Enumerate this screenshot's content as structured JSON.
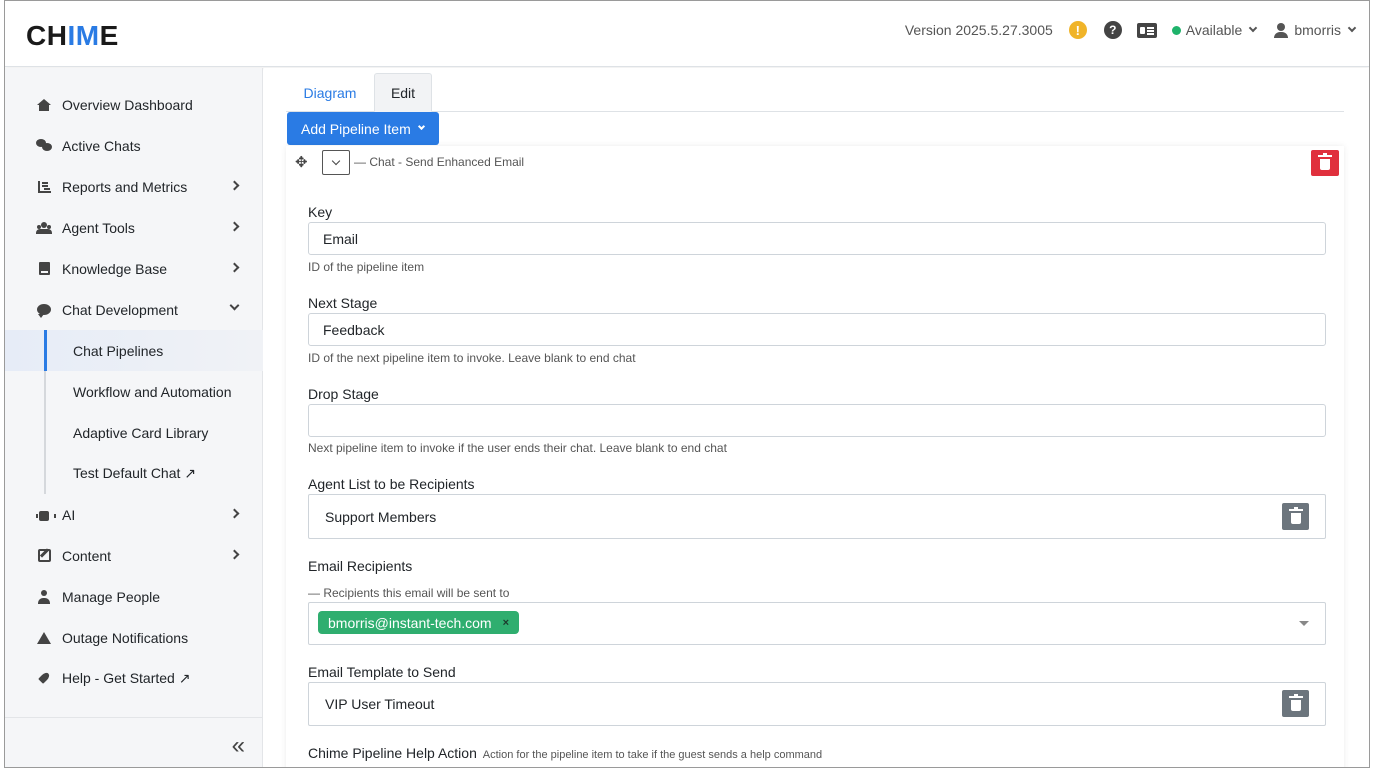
{
  "header": {
    "logo_prefix": "CH",
    "logo_accent": "IM",
    "logo_suffix": "E",
    "version": "Version 2025.5.27.3005",
    "warn_glyph": "!",
    "help_glyph": "?",
    "status": "Available",
    "status_color": "#1fb36b",
    "username": "bmorris"
  },
  "sidebar": {
    "items": [
      {
        "label": "Overview Dashboard",
        "icon": "home-icon"
      },
      {
        "label": "Active Chats",
        "icon": "chats-icon"
      },
      {
        "label": "Reports and Metrics",
        "icon": "reports-icon"
      },
      {
        "label": "Agent Tools",
        "icon": "users-icon"
      },
      {
        "label": "Knowledge Base",
        "icon": "book-icon"
      },
      {
        "label": "Chat Development",
        "icon": "comment-icon"
      }
    ],
    "sub_items": [
      {
        "label": "Chat Pipelines",
        "active": true
      },
      {
        "label": "Workflow and Automation"
      },
      {
        "label": "Adaptive Card Library"
      },
      {
        "label": "Test Default Chat ↗"
      }
    ],
    "items_after": [
      {
        "label": "AI",
        "icon": "robot-icon"
      },
      {
        "label": "Content",
        "icon": "edit-icon"
      },
      {
        "label": "Manage People",
        "icon": "person-icon"
      },
      {
        "label": "Outage Notifications",
        "icon": "alert-icon"
      },
      {
        "label": "Help - Get Started ↗",
        "icon": "rocket-icon"
      }
    ],
    "collapse_glyph": "«"
  },
  "main": {
    "tabs": [
      {
        "label": "Diagram",
        "active": false
      },
      {
        "label": "Edit",
        "active": true
      }
    ],
    "add_button": "Add Pipeline Item",
    "item_title": "— Chat - Send Enhanced Email",
    "accent_color": "#2a7be4",
    "danger_color": "#e0303d",
    "fields": {
      "key": {
        "label": "Key",
        "value": "Email",
        "help": "ID of the pipeline item"
      },
      "next_stage": {
        "label": "Next Stage",
        "value": "Feedback",
        "help": "ID of the next pipeline item to invoke. Leave blank to end chat"
      },
      "drop_stage": {
        "label": "Drop Stage",
        "value": "",
        "help": "Next pipeline item to invoke if the user ends their chat. Leave blank to end chat"
      },
      "agent_list": {
        "label": "Agent List to be Recipients",
        "value": "Support Members"
      },
      "email_recipients": {
        "label": "Email Recipients",
        "help": "— Recipients this email will be sent to",
        "tags": [
          "bmorris@instant-tech.com"
        ],
        "tag_remove_glyph": "×"
      },
      "email_template": {
        "label": "Email Template to Send",
        "value": "VIP User Timeout"
      },
      "help_action": {
        "label": "Chime Pipeline Help Action",
        "help": "Action for the pipeline item to take if the guest sends a help command"
      }
    }
  }
}
